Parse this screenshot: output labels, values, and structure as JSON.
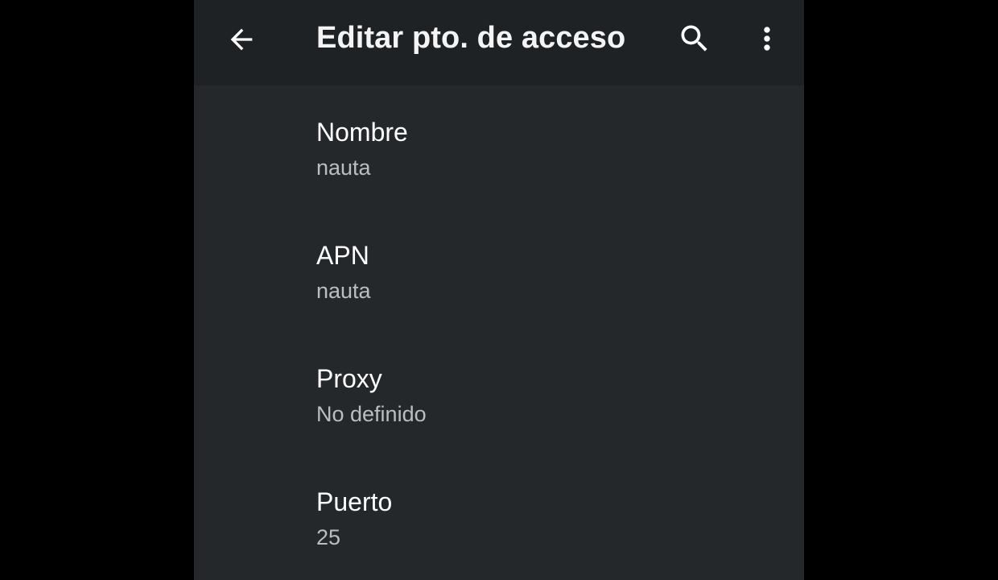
{
  "app_bar": {
    "title": "Editar pto. de acceso",
    "back_icon": "arrow-back-icon",
    "search_icon": "search-icon",
    "more_icon": "more-vert-icon"
  },
  "preferences": [
    {
      "title": "Nombre",
      "summary": "nauta"
    },
    {
      "title": "APN",
      "summary": "nauta"
    },
    {
      "title": "Proxy",
      "summary": "No definido"
    },
    {
      "title": "Puerto",
      "summary": "25"
    }
  ],
  "colors": {
    "outer_background": "#000000",
    "screen_background": "#25282b",
    "app_bar_background": "#1f2225",
    "primary_text": "#ffffff",
    "secondary_text": "#bdbdbd"
  }
}
